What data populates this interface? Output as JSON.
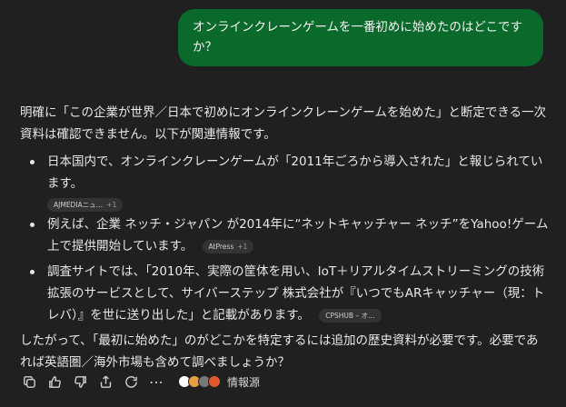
{
  "user_message": "オンラインクレーンゲームを一番初めに始めたのはどこですか？",
  "answer": {
    "intro": "明確に「この企業が世界／日本で初めにオンラインクレーンゲームを始めた」と断定できる一次資料は確認できません。以下が関連情報です。",
    "bullets": [
      {
        "text": "日本国内で、オンラインクレーンゲームが「2011年ごろから導入された」と報じられています。",
        "source": "AJMEDIAニュ…",
        "count": "+1"
      },
      {
        "text": "例えば、企業 ネッチ・ジャパン が2014年に“ネットキャッチャー ネッチ”をYahoo!ゲーム上で提供開始しています。",
        "source": "AtPress",
        "count": "+1"
      },
      {
        "text": "調査サイトでは、「2010年、実際の筐体を用い、IoT＋リアルタイムストリーミングの技術拡張のサービスとして、サイバーステップ 株式会社が『いつでもARキャッチャー（現：トレバ）』を世に送り出した」と記載があります。",
        "source": "CPSHUB – オ…",
        "count": ""
      }
    ],
    "conclusion": "したがって、「最初に始めた」のがどこかを特定するには追加の歴史資料が必要です。必要であれば英語圏／海外市場も含めて調べましょうか？"
  },
  "toolbar": {
    "sources_label": "情報源",
    "more": "⋯",
    "source_favicon_colors": [
      "#ffffff",
      "#e8a040",
      "#777777",
      "#e05a2b"
    ]
  }
}
